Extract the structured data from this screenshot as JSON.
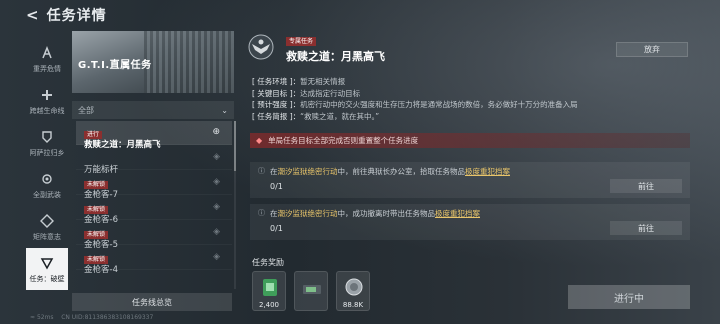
{
  "header": {
    "title": "任务详情"
  },
  "nav": [
    {
      "label": "重弄危情",
      "icon": "lambda-icon"
    },
    {
      "label": "跨越生命线",
      "icon": "cross-plus-icon"
    },
    {
      "label": "阿萨拉归乡",
      "icon": "shield-icon"
    },
    {
      "label": "全副武装",
      "icon": "gear-icon"
    },
    {
      "label": "矩阵意志",
      "icon": "diamond-icon"
    },
    {
      "label": "任务：破壁",
      "icon": "triangle-icon"
    }
  ],
  "banner": {
    "title": "G.T.I.直属任务"
  },
  "filter": {
    "value": "全部"
  },
  "tasks": [
    {
      "tag": "进行",
      "name": "救赎之道：月黑高飞"
    },
    {
      "tag": "",
      "name": "万能标杆"
    },
    {
      "tag": "未解锁",
      "name": "金枪客-7"
    },
    {
      "tag": "未解锁",
      "name": "金枪客-6"
    },
    {
      "tag": "未解锁",
      "name": "金枪客-5"
    },
    {
      "tag": "未解锁",
      "name": "金枪客-4"
    }
  ],
  "overview_button": "任务线总览",
  "mission": {
    "tag": "专属任务",
    "title": "救赎之道：月黑高飞",
    "abandon": "放弃",
    "info": [
      {
        "key": "[ 任务环境 ]：",
        "value": "暂无相关情报"
      },
      {
        "key": "[ 关键目标 ]：",
        "value": "达成指定行动目标"
      },
      {
        "key": "[ 预计强度 ]：",
        "value": "机密行动中的交火强度和生存压力将是通常战场的数倍，务必做好十万分的准备入局"
      },
      {
        "key": "[ 任务简报 ]：",
        "value": "“救赎之道，就在其中。”"
      }
    ],
    "warning": "单局任务目标全部完成否则重置整个任务进度",
    "objectives": [
      {
        "pre": "在",
        "place": "潮汐监狱绝密行动",
        "mid": "中，前往典狱长办公室，拾取任务物品",
        "item": "极度重犯档案",
        "progress": "0/1",
        "button": "前往"
      },
      {
        "pre": "在",
        "place": "潮汐监狱绝密行动",
        "mid": "中，成功撤离时带出任务物品",
        "item": "极度重犯档案",
        "progress": "0/1",
        "button": "前往"
      }
    ],
    "rewards_label": "任务奖励",
    "rewards": [
      {
        "value": "2,400",
        "icon": "green-card-icon"
      },
      {
        "value": "",
        "icon": "ammo-box-icon"
      },
      {
        "value": "88.8K",
        "icon": "coin-icon"
      }
    ],
    "status_button": "进行中"
  },
  "footer": {
    "ping": "52ms",
    "uid": "CN UID:811386383108169337"
  }
}
